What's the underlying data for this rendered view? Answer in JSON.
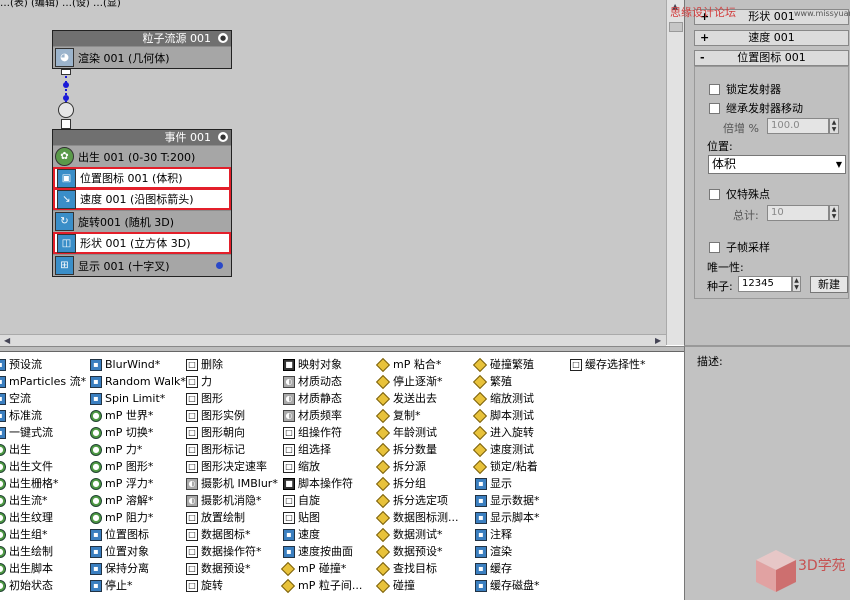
{
  "top_text": "…(表)  (编辑)  …(设)  …(显)",
  "watermark": "思缘设计论坛",
  "watermark_site": "www.missyuan.com",
  "node_source": {
    "title": "粒子流源 001",
    "ops": [
      {
        "icon": "render-icon",
        "label": "渲染 001 (几何体)"
      }
    ]
  },
  "node_event": {
    "title": "事件 001",
    "ops": [
      {
        "label": "出生 001 (0-30 T:200)"
      },
      {
        "label": "位置图标 001 (体积)"
      },
      {
        "label": "速度 001 (沿图标箭头)"
      },
      {
        "label": "旋转001 (随机 3D)"
      },
      {
        "label": "形状 001 (立方体 3D)"
      },
      {
        "label": "显示 001 (十字叉)"
      }
    ]
  },
  "depot": {
    "col1": [
      "预设流",
      "mParticles 流*",
      "空流",
      "标准流",
      "一键式流",
      "出生",
      "出生文件",
      "出生栅格*",
      "出生流*",
      "出生纹理",
      "出生组*",
      "出生绘制",
      "出生脚本",
      "初始状态"
    ],
    "col2": [
      "BlurWind*",
      "Random Walk*",
      "Spin Limit*",
      "mP 世界*",
      "mP 切换*",
      "mP 力*",
      "mP 图形*",
      "mP 浮力*",
      "mP 溶解*",
      "mP 阻力*",
      "位置图标",
      "位置对象",
      "保持分离",
      "停止*"
    ],
    "col3": [
      "删除",
      "力",
      "图形",
      "图形实例",
      "图形朝向",
      "图形标记",
      "图形决定速率",
      "摄影机 IMBlur*",
      "摄影机消隐*",
      "放置绘制",
      "数据图标*",
      "数据操作符*",
      "数据预设*",
      "旋转"
    ],
    "col4": [
      "映射对象",
      "材质动态",
      "材质静态",
      "材质频率",
      "组操作符",
      "组选择",
      "缩放",
      "脚本操作符",
      "自旋",
      "贴图",
      "速度",
      "速度按曲面",
      "mP 碰撞*",
      "mP 粒子间..."
    ],
    "col5": [
      "mP 粘合*",
      "停止逐渐*",
      "发送出去",
      "复制*",
      "年龄测试",
      "拆分数量",
      "拆分源",
      "拆分组",
      "拆分选定项",
      "数据图标测...",
      "数据测试*",
      "数据预设*",
      "查找目标",
      "碰撞"
    ],
    "col6": [
      "碰撞繁殖",
      "繁殖",
      "缩放测试",
      "脚本测试",
      "进入旋转",
      "速度测试",
      "锁定/粘着",
      "显示",
      "显示数据*",
      "显示脚本*",
      "注释",
      "渲染",
      "缓存",
      "缓存磁盘*"
    ],
    "col7": [
      "缓存选择性*"
    ]
  },
  "props": {
    "rollouts": [
      {
        "sign": "+",
        "title": "形状 001"
      },
      {
        "sign": "+",
        "title": "速度 001"
      },
      {
        "sign": "-",
        "title": "位置图标 001"
      }
    ],
    "lock_emitter": "锁定发射器",
    "inherit_motion": "继承发射器移动",
    "multiplier_label": "倍增 %",
    "multiplier_value": "100.0",
    "location_label": "位置:",
    "location_value": "体积",
    "distinct_points": "仅特殊点",
    "total_label": "总计:",
    "total_value": "10",
    "subframe": "子帧采样",
    "uniqueness_label": "唯一性:",
    "seed_label": "种子:",
    "seed_value": "12345",
    "new_button": "新建"
  },
  "description_label": "描述:",
  "logo_text": "3D学苑"
}
